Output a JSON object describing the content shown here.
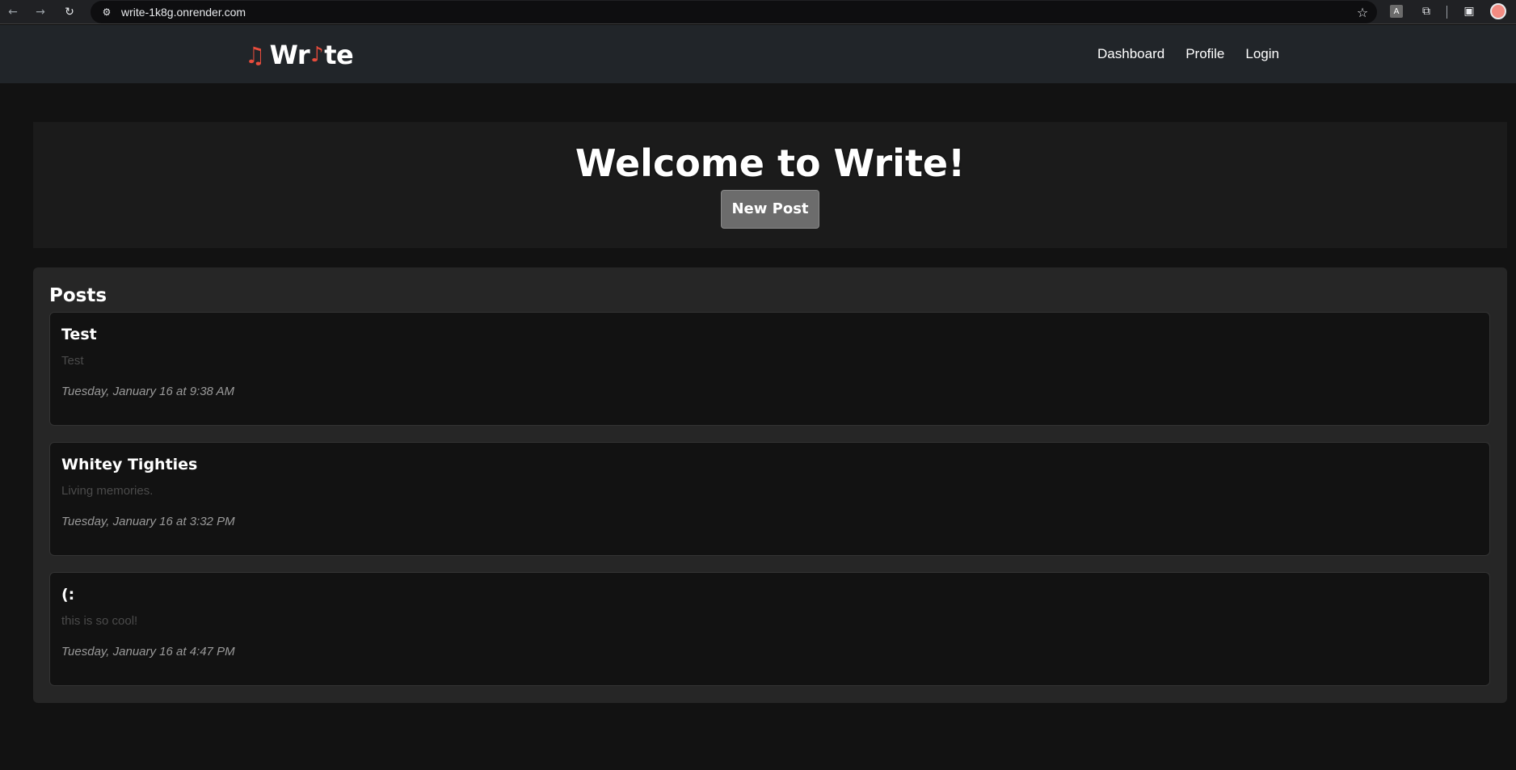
{
  "browser": {
    "back_icon": "←",
    "forward_icon": "→",
    "reload_icon": "↻",
    "site_info_icon": "⚙",
    "url": "write-1k8g.onrender.com",
    "star_icon": "☆",
    "translate_ext_icon": "A",
    "puzzle_ext_icon": "⧉",
    "sidepanel_icon": "▣"
  },
  "site": {
    "brand": {
      "note_icon": "♫",
      "text_prefix": "Wr",
      "inline_note": "♪",
      "text_suffix": "te",
      "accent_color": "#e74c3c"
    },
    "nav": {
      "items": [
        {
          "label": "Dashboard"
        },
        {
          "label": "Profile"
        },
        {
          "label": "Login"
        }
      ]
    }
  },
  "hero": {
    "title": "Welcome to Write!",
    "new_post_label": "New Post"
  },
  "posts": {
    "heading": "Posts",
    "items": [
      {
        "title": "Test",
        "body": "Test",
        "date": "Tuesday, January 16 at 9:38 AM"
      },
      {
        "title": "Whitey Tighties",
        "body": "Living memories.",
        "date": "Tuesday, January 16 at 3:32 PM"
      },
      {
        "title": "(:",
        "body": "this is so cool!",
        "date": "Tuesday, January 16 at 4:47 PM"
      }
    ]
  }
}
